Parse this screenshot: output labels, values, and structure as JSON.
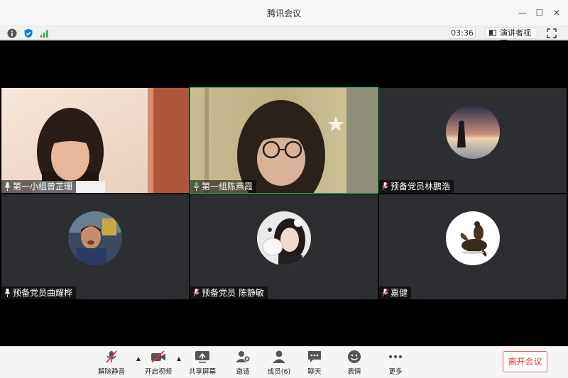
{
  "window": {
    "title": "腾讯会议",
    "minimize_glyph": "—",
    "maximize_glyph": "☐",
    "close_glyph": "✕"
  },
  "infobar": {
    "timer": "03:36",
    "speaker_view_label": "演讲者视图",
    "signal_color": "#2bb14a"
  },
  "participants": [
    {
      "name": "第一小组曾芷珊",
      "mic": "on",
      "video": true
    },
    {
      "name": "第一组陈燕霞",
      "mic": "speaking",
      "video": true
    },
    {
      "name": "预备党员林鹏浩",
      "mic": "muted",
      "video": false
    },
    {
      "name": "预备党员曲耀桦",
      "mic": "on",
      "video": false
    },
    {
      "name": "预备党员 陈静敏",
      "mic": "muted",
      "video": false
    },
    {
      "name": "嘉健",
      "mic": "muted",
      "video": false
    }
  ],
  "toolbar": {
    "unmute_label": "解除静音",
    "start_video_label": "开启视频",
    "share_screen_label": "共享屏幕",
    "invite_label": "邀请",
    "members_label": "成员(6)",
    "chat_label": "聊天",
    "reactions_label": "表情",
    "more_label": "更多",
    "leave_label": "离开会议"
  },
  "colors": {
    "accent": "#1a7bd6",
    "danger": "#e0393e",
    "active_speaker": "#3ec36b",
    "tile_bg": "#2c2e32"
  }
}
